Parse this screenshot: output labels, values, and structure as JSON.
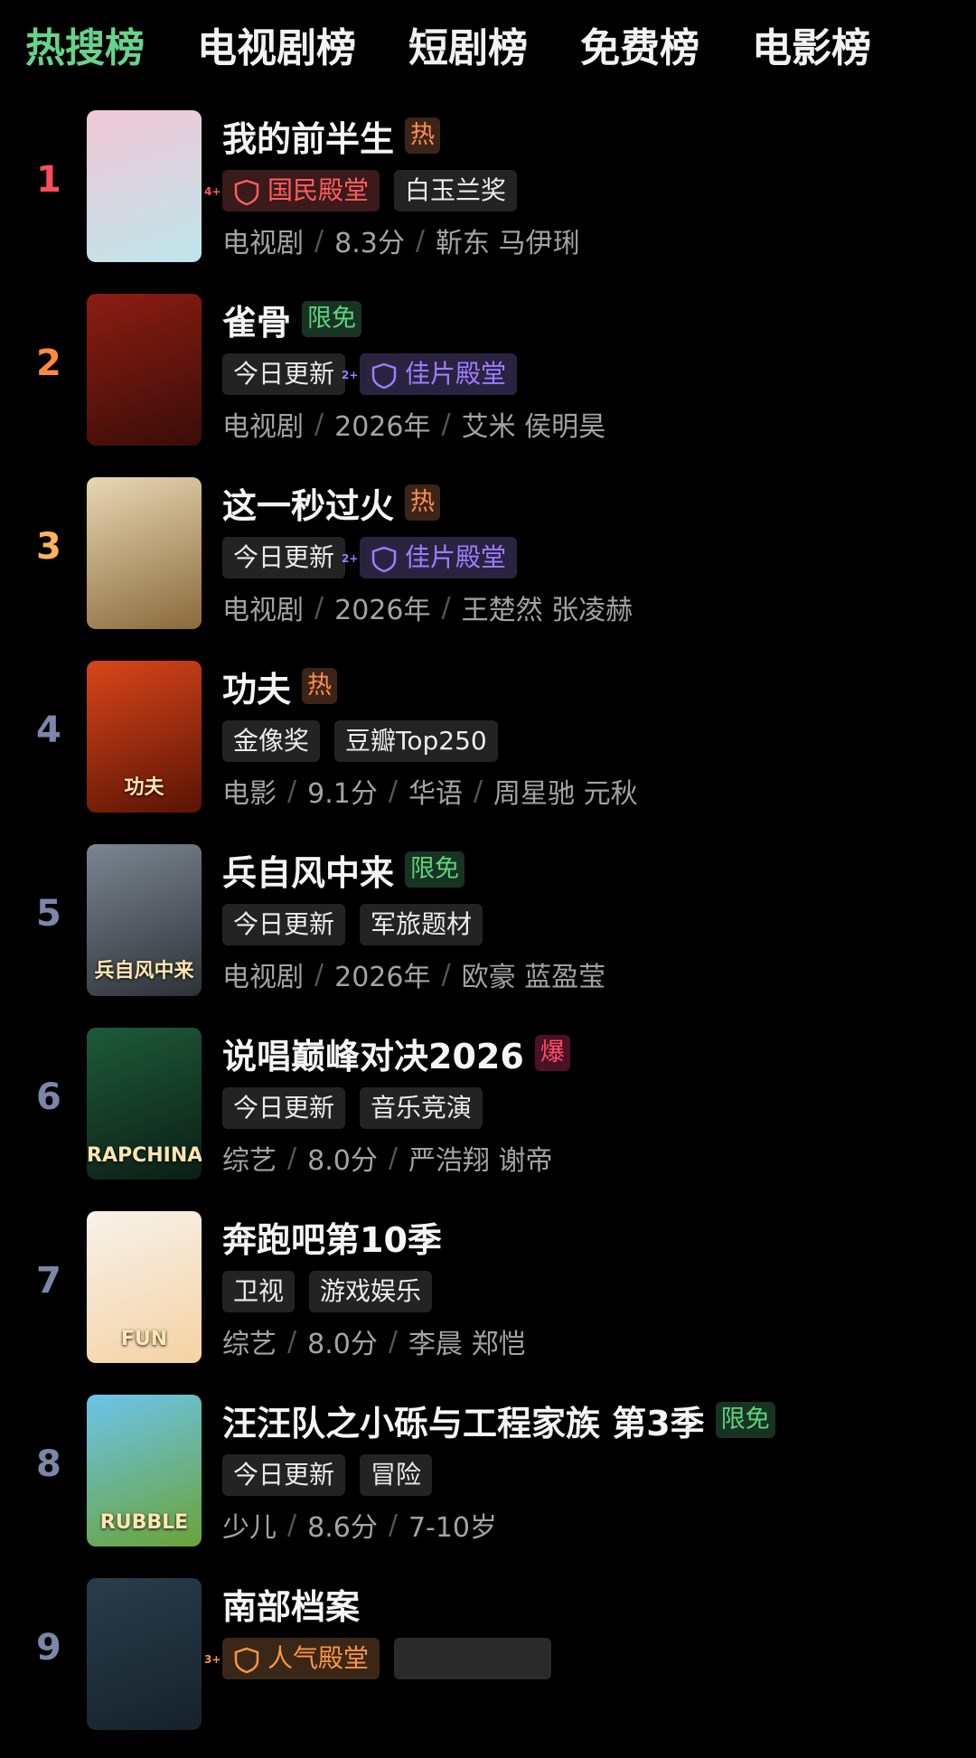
{
  "tabs": [
    {
      "label": "热搜榜",
      "active": true
    },
    {
      "label": "电视剧榜"
    },
    {
      "label": "短剧榜"
    },
    {
      "label": "免费榜"
    },
    {
      "label": "电影榜"
    }
  ],
  "items": [
    {
      "rank": "1",
      "title": "我的前半生",
      "mark": "热",
      "tags": [
        {
          "label": "国民殿堂",
          "style": "red",
          "badge": "4+"
        },
        {
          "label": "白玉兰奖"
        }
      ],
      "meta": [
        "电视剧",
        "8.3分",
        "靳东 马伊琍"
      ],
      "poster_colors": [
        "#f3c7d6",
        "#bde6ea"
      ]
    },
    {
      "rank": "2",
      "title": "雀骨",
      "mark": "限免",
      "tags": [
        {
          "label": "今日更新"
        },
        {
          "label": "佳片殿堂",
          "style": "purple",
          "badge": "2+"
        }
      ],
      "meta": [
        "电视剧",
        "2026年",
        "艾米 侯明昊"
      ],
      "poster_colors": [
        "#8c1d12",
        "#3a0d08"
      ]
    },
    {
      "rank": "3",
      "title": "这一秒过火",
      "mark": "热",
      "tags": [
        {
          "label": "今日更新"
        },
        {
          "label": "佳片殿堂",
          "style": "purple",
          "badge": "2+"
        }
      ],
      "meta": [
        "电视剧",
        "2026年",
        "王楚然 张凌赫"
      ],
      "poster_colors": [
        "#e8d7b4",
        "#8a6a3c"
      ]
    },
    {
      "rank": "4",
      "title": "功夫",
      "mark": "热",
      "tags": [
        {
          "label": "金像奖"
        },
        {
          "label": "豆瓣Top250"
        }
      ],
      "meta": [
        "电影",
        "9.1分",
        "华语",
        "周星驰 元秋"
      ],
      "poster_colors": [
        "#d9461a",
        "#5a1305"
      ],
      "poster_text": "功夫"
    },
    {
      "rank": "5",
      "title": "兵自风中来",
      "mark": "限免",
      "tags": [
        {
          "label": "今日更新"
        },
        {
          "label": "军旅题材"
        }
      ],
      "meta": [
        "电视剧",
        "2026年",
        "欧豪 蓝盈莹"
      ],
      "poster_colors": [
        "#7c8590",
        "#2d3238"
      ],
      "poster_text": "兵自风中来"
    },
    {
      "rank": "6",
      "title": "说唱巅峰对决2026",
      "mark": "爆",
      "tags": [
        {
          "label": "今日更新"
        },
        {
          "label": "音乐竞演"
        }
      ],
      "meta": [
        "综艺",
        "8.0分",
        "严浩翔 谢帝"
      ],
      "poster_colors": [
        "#1e5a3a",
        "#0b1e14"
      ],
      "poster_text": "RAPCHINA"
    },
    {
      "rank": "7",
      "title": "奔跑吧第10季",
      "mark": "",
      "tags": [
        {
          "label": "卫视"
        },
        {
          "label": "游戏娱乐"
        }
      ],
      "meta": [
        "综艺",
        "8.0分",
        "李晨 郑恺"
      ],
      "poster_colors": [
        "#f7f2ea",
        "#f5d2a4"
      ],
      "poster_text": "FUN"
    },
    {
      "rank": "8",
      "title": "汪汪队之小砾与工程家族 第3季",
      "mark": "限免",
      "tags": [
        {
          "label": "今日更新"
        },
        {
          "label": "冒险"
        }
      ],
      "meta": [
        "少儿",
        "8.6分",
        "7-10岁"
      ],
      "poster_colors": [
        "#6cc4ea",
        "#6aa338"
      ],
      "poster_text": "RUBBLE"
    },
    {
      "rank": "9",
      "title": "南部档案",
      "mark": "",
      "tags": [
        {
          "label": "人气殿堂",
          "style": "orange",
          "badge": "3+"
        },
        {
          "label": "",
          "style": "blur"
        }
      ],
      "meta": [],
      "poster_colors": [
        "#2a3d4a",
        "#15222b"
      ]
    }
  ]
}
